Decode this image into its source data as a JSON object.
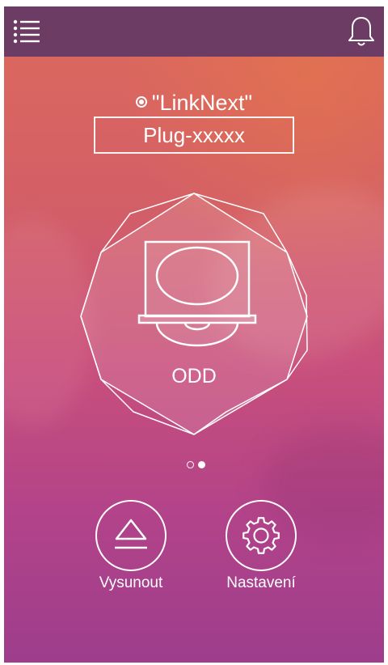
{
  "header": {
    "menu_icon": "list-menu-icon",
    "notification_icon": "bell-icon"
  },
  "network": {
    "name": "\"LinkNext\"",
    "status_icon": "radio-dot-icon"
  },
  "device_selector": {
    "value": "Plug-xxxxx"
  },
  "device_card": {
    "icon": "optical-disc-drive-icon",
    "label": "ODD"
  },
  "pager": {
    "total": 2,
    "active_index": 1
  },
  "actions": [
    {
      "label": "Vysunout",
      "icon": "eject-icon"
    },
    {
      "label": "Nastavení",
      "icon": "gear-icon"
    }
  ],
  "colors": {
    "topbar": "#6d3c65",
    "gradient_top": "#dd6a5c",
    "gradient_bottom": "#9d3d8c",
    "foreground": "#ffffff"
  }
}
